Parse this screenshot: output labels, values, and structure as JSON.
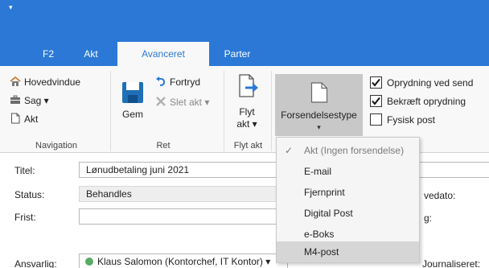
{
  "quick_access": {
    "arrow": "▾"
  },
  "tabs": [
    {
      "label": "F2"
    },
    {
      "label": "Akt"
    },
    {
      "label": "Avanceret",
      "active": true
    },
    {
      "label": "Parter"
    }
  ],
  "ribbon": {
    "navigation": {
      "label": "Navigation",
      "items": [
        {
          "label": "Hovedvindue",
          "icon": "home-icon"
        },
        {
          "label": "Sag ▾",
          "icon": "briefcase-icon"
        },
        {
          "label": "Akt",
          "icon": "document-icon"
        }
      ]
    },
    "ret": {
      "label": "Ret",
      "gem": "Gem",
      "fortryd": "Fortryd",
      "slet_akt": "Slet akt ▾"
    },
    "flyt_akt": {
      "label": "Flyt akt",
      "button_line1": "Flyt",
      "button_line2": "akt ▾"
    },
    "forsendelse": {
      "label": "Forsendelsestype",
      "arrow": "▾"
    },
    "checks": [
      {
        "label": "Oprydning ved send",
        "checked": true
      },
      {
        "label": "Bekræft oprydning",
        "checked": true
      },
      {
        "label": "Fysisk post",
        "checked": false
      }
    ]
  },
  "dropdown": {
    "items": [
      {
        "label": "Akt (Ingen forsendelse)",
        "checked": true
      },
      {
        "label": "E-mail"
      },
      {
        "label": "Fjernprint"
      },
      {
        "label": "Digital Post"
      },
      {
        "label": "e-Boks"
      },
      {
        "label": "M4-post",
        "selected": true
      }
    ]
  },
  "form": {
    "titel_label": "Titel:",
    "titel_value": "Lønudbetaling juni 2021",
    "status_label": "Status:",
    "status_value": "Behandles",
    "frist_label": "Frist:",
    "frist_value": "",
    "ansvarlig_label": "Ansvarlig:",
    "ansvarlig_value": "Klaus Salomon (Kontorchef, IT Kontor) ▾",
    "vedato_partial": "vedato:",
    "g_partial": "g:",
    "journaliseret_label": "Journaliseret:"
  },
  "colors": {
    "title_blue": "#2b78d6",
    "ribbon_bg": "#f8f8f8",
    "status_green": "#5aaa64"
  }
}
